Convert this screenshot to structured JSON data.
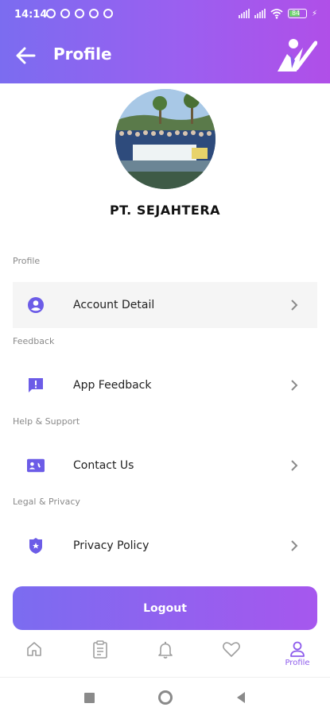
{
  "status_bar": {
    "time": "14:14",
    "battery": "84"
  },
  "app_bar": {
    "title": "Profile"
  },
  "profile": {
    "company_name": "PT. SEJAHTERA"
  },
  "sections": [
    {
      "label": "Profile",
      "item": {
        "label": "Account Detail",
        "icon": "account-circle-icon"
      }
    },
    {
      "label": "Feedback",
      "item": {
        "label": "App Feedback",
        "icon": "feedback-icon"
      }
    },
    {
      "label": "Help & Support",
      "item": {
        "label": "Contact Us",
        "icon": "contact-card-icon"
      }
    },
    {
      "label": "Legal & Privacy",
      "item": {
        "label": "Privacy Policy",
        "icon": "police-badge-icon"
      }
    }
  ],
  "logout": {
    "label": "Logout"
  },
  "bottom_nav": {
    "items": [
      {
        "icon": "home-icon"
      },
      {
        "icon": "clipboard-icon"
      },
      {
        "icon": "bell-icon"
      },
      {
        "icon": "heart-icon"
      },
      {
        "icon": "profile-icon",
        "label": "Profile",
        "active": true
      }
    ]
  },
  "colors": {
    "accent": "#8e5cec",
    "gradient_start": "#7b6cf0",
    "gradient_end": "#b04fe8",
    "icon": "#6c5ce7"
  }
}
